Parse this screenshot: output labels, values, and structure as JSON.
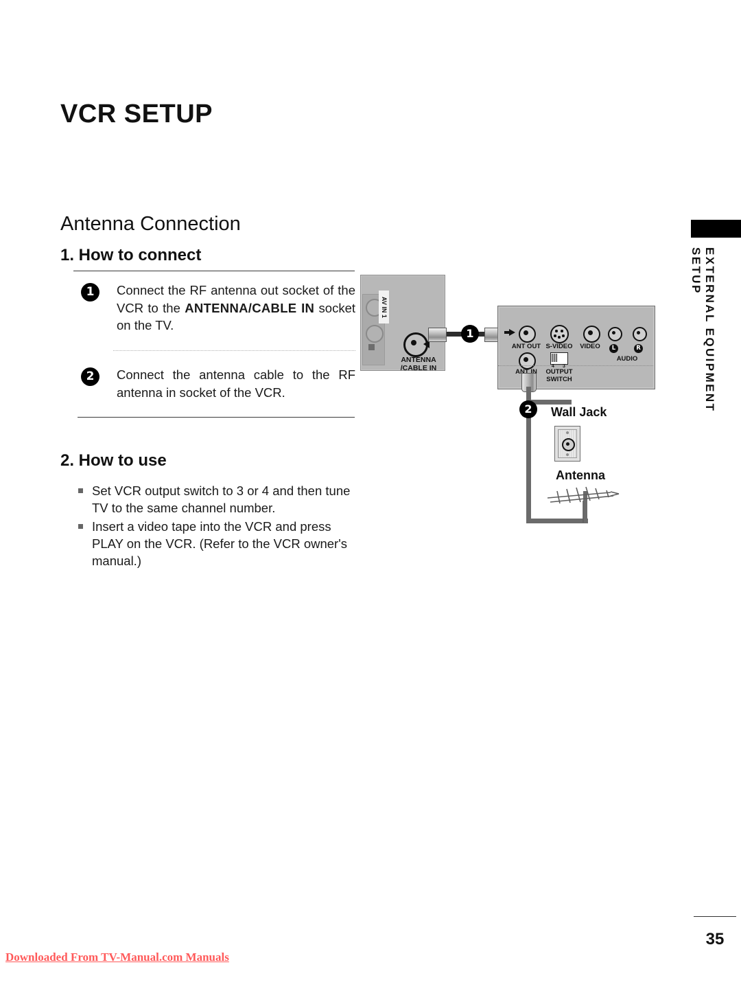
{
  "page": {
    "title": "VCR SETUP",
    "section_heading": "Antenna Connection",
    "number": "35"
  },
  "connect": {
    "subheading": "1. How to connect",
    "steps": [
      {
        "badge": "1",
        "text_before": "Connect the RF antenna out socket of the VCR to the ",
        "emphasis": "ANTENNA/CABLE IN",
        "text_after": " socket on the TV."
      },
      {
        "badge": "2",
        "text_before": "Connect the antenna cable to the RF antenna in socket of the VCR.",
        "emphasis": "",
        "text_after": ""
      }
    ]
  },
  "use": {
    "subheading": "2. How to use",
    "bullets": [
      "Set VCR output switch to 3 or 4 and then tune TV to the same channel number.",
      "Insert a video tape into the VCR and press PLAY on the VCR. (Refer to the VCR owner's manual.)"
    ]
  },
  "side_tab": {
    "label": "EXTERNAL EQUIPMENT SETUP"
  },
  "diagram": {
    "tv": {
      "av_label": "AV IN 1",
      "antenna_label": "ANTENNA\n/CABLE IN",
      "antenna_label_line1": "ANTENNA",
      "antenna_label_line2": "/CABLE IN"
    },
    "cable_badge_1": "1",
    "cable_badge_2": "2",
    "vcr": {
      "ant_out": "ANT OUT",
      "s_video": "S-VIDEO",
      "video": "VIDEO",
      "audio": "AUDIO",
      "audio_left": "L",
      "audio_right": "R",
      "ant_in": "ANT IN",
      "output_switch_line1": "OUTPUT",
      "output_switch_line2": "SWITCH",
      "switch_tick_4": "4",
      "switch_tick_3": "3"
    },
    "wall_jack_label": "Wall Jack",
    "antenna_label": "Antenna"
  },
  "footer": {
    "link_text": "Downloaded From TV-Manual.com Manuals"
  },
  "colors": {
    "panel_gray": "#b8b8b8",
    "badge_black": "#000000",
    "footer_red": "#ff5a5a"
  }
}
